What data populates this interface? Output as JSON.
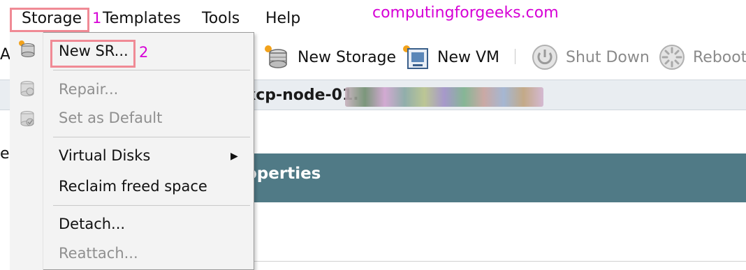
{
  "menubar": {
    "items": [
      {
        "label": "Storage"
      },
      {
        "label": "Templates"
      },
      {
        "label": "Tools"
      },
      {
        "label": "Help"
      }
    ],
    "annotation_1": "1",
    "annotation_2": "2",
    "watermark": "computingforgeeks.com"
  },
  "toolbar": {
    "left_edge_char": "A",
    "new_storage_label": "New Storage",
    "new_vm_label": "New VM",
    "shut_down_label": "Shut Down",
    "reboot_label": "Reboot"
  },
  "titlebar": {
    "host_name": "xcp-node-01."
  },
  "content": {
    "properties_label": "operties",
    "left_edge_char": "e"
  },
  "dropdown": {
    "items": [
      {
        "label": "New SR...",
        "enabled": true
      },
      {
        "label": "Repair...",
        "enabled": false
      },
      {
        "label": "Set as Default",
        "enabled": false
      },
      {
        "label": "Virtual Disks",
        "enabled": true,
        "has_submenu": true
      },
      {
        "label": "Reclaim freed space",
        "enabled": true
      },
      {
        "label": "Detach...",
        "enabled": true
      },
      {
        "label": "Reattach...",
        "enabled": false
      }
    ]
  },
  "colors": {
    "highlight_box": "#f08a95",
    "annotation": "#d600d6",
    "properties_header": "#507a86"
  },
  "icons": [
    "storage-icon",
    "new-storage-icon",
    "new-vm-icon",
    "shut-down-icon",
    "reboot-icon",
    "repair-icon",
    "set-default-icon",
    "submenu-arrow-icon"
  ]
}
